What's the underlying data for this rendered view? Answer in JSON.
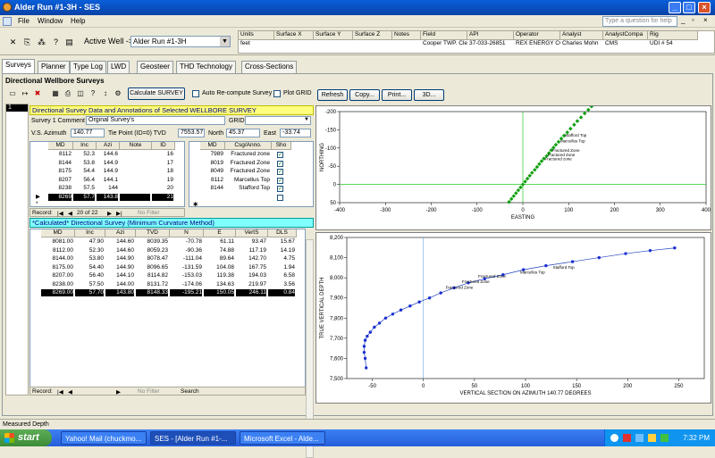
{
  "window": {
    "title": "Alder Run #1-3H - SES",
    "help_placeholder": "Type a question for help"
  },
  "menu": [
    "File",
    "Window",
    "Help"
  ],
  "toolbar": {
    "active_well_label": "Active Well ->",
    "active_well_value": "Alder Run #1-3H"
  },
  "info_grid": {
    "headers": [
      "Units",
      "Surface X",
      "Surface Y",
      "Surface Z",
      "Notes",
      "Field",
      "API",
      "Operator",
      "Analyst",
      "AnalystCompa",
      "Rig"
    ],
    "values": [
      "feet",
      "",
      "",
      "",
      "",
      "Cooper TWP. Cle",
      "37-033-26851",
      "REX ENERGY CO",
      "Charles Mohn",
      "CMS",
      "UDI # 54"
    ]
  },
  "tabs": [
    "Surveys",
    "Planner",
    "Type Log",
    "LWD",
    "Geosteer",
    "THD Technology",
    "Cross-Sections"
  ],
  "surveys": {
    "title": "Directional Wellbore Surveys",
    "calc_button": "Calculate SURVEY",
    "auto_label": "Auto Re-compute Survey",
    "plot_label": "Plot GRID",
    "row_num": "1",
    "section1_title": "Directional Survey Data and Annotations of Selected WELLBORE SURVEY",
    "comment_label": "Survey 1 Comment",
    "comment_value": "Orginal Survey's",
    "grid_label": "GRID",
    "vs_label": "V.S. Azimuth",
    "vs_value": "140.77",
    "tie_label": "Tie Point (ID=0)  TVD",
    "tie_value": "7553.57",
    "north_label": "North",
    "north_value": "45.37",
    "east_label": "East",
    "east_value": "-33.74",
    "survey_headers": [
      "MD",
      "Inc",
      "Azi",
      "Note",
      "ID"
    ],
    "survey_rows": [
      [
        "8112",
        "52.3",
        "144.6",
        "",
        "16"
      ],
      [
        "8144",
        "53.8",
        "144.9",
        "",
        "17"
      ],
      [
        "8175",
        "54.4",
        "144.9",
        "",
        "18"
      ],
      [
        "8207",
        "56.4",
        "144.1",
        "",
        "19"
      ],
      [
        "8238",
        "57.5",
        "144",
        "",
        "20"
      ],
      [
        "8269",
        "57.7",
        "143.8",
        "",
        "21"
      ]
    ],
    "annot_headers": [
      "MD",
      "Csg/Anno.",
      "Sho"
    ],
    "annot_rows": [
      [
        "7989",
        "Fractured zone"
      ],
      [
        "8019",
        "Fractured Zone"
      ],
      [
        "8049",
        "Fractured Zone"
      ],
      [
        "8112",
        "Marcellus Top"
      ],
      [
        "8144",
        "Stafford Top"
      ]
    ],
    "record1": {
      "label": "Record:",
      "text": "20 of 22",
      "filter": "No Filter"
    },
    "section2_title": "*Calculated* Directional Survey (Minimum Curvature Method)",
    "calc_headers": [
      "MD",
      "Inc",
      "Azi",
      "TVD",
      "N",
      "E",
      "VertS",
      "DLS"
    ],
    "calc_rows": [
      [
        "8081.00",
        "47.90",
        "144.60",
        "8039.35",
        "-70.78",
        "61.11",
        "93.47",
        "15.67"
      ],
      [
        "8112.00",
        "52.30",
        "144.60",
        "8059.23",
        "-90.36",
        "74.88",
        "117.19",
        "14.19"
      ],
      [
        "8144.00",
        "53.80",
        "144.90",
        "8078.47",
        "-111.04",
        "89.64",
        "142.70",
        "4.75"
      ],
      [
        "8175.00",
        "54.40",
        "144.90",
        "8096.65",
        "-131.59",
        "104.08",
        "167.75",
        "1.94"
      ],
      [
        "8207.00",
        "56.40",
        "144.10",
        "8114.82",
        "-153.03",
        "119.38",
        "194.03",
        "6.58"
      ],
      [
        "8238.00",
        "57.50",
        "144.00",
        "8131.72",
        "-174.06",
        "134.63",
        "219.97",
        "3.56"
      ],
      [
        "8269.00",
        "57.70",
        "143.80",
        "8148.33",
        "-195.21",
        "150.05",
        "246.11",
        "0.84"
      ]
    ],
    "record2": {
      "label": "Record:",
      "filter": "No Filter",
      "search": "Search"
    }
  },
  "chart_buttons": [
    "Refresh",
    "Copy...",
    "Print...",
    "3D..."
  ],
  "chart_data": [
    {
      "type": "scatter",
      "xlabel": "EASTING",
      "ylabel": "NORTHING",
      "xlim": [
        -400,
        400
      ],
      "ylim": [
        -200,
        50
      ],
      "xticks": [
        -400,
        -300,
        -200,
        -100,
        0,
        100,
        200,
        300,
        400
      ],
      "yticks": [
        50,
        0,
        -50,
        -100,
        -150,
        -200
      ],
      "points": [
        [
          -30,
          48
        ],
        [
          -25,
          40
        ],
        [
          -20,
          32
        ],
        [
          -15,
          24
        ],
        [
          -10,
          16
        ],
        [
          -5,
          8
        ],
        [
          0,
          0
        ],
        [
          5,
          -8
        ],
        [
          10,
          -16
        ],
        [
          15,
          -24
        ],
        [
          20,
          -32
        ],
        [
          26,
          -40
        ],
        [
          31,
          -48
        ],
        [
          36,
          -56
        ],
        [
          41,
          -64
        ],
        [
          46,
          -71
        ],
        [
          52,
          -78
        ],
        [
          57,
          -86
        ],
        [
          62,
          -94
        ],
        [
          67,
          -101
        ],
        [
          72,
          -109
        ],
        [
          78,
          -117
        ],
        [
          84,
          -126
        ],
        [
          90,
          -134
        ],
        [
          97,
          -143
        ],
        [
          104,
          -153
        ],
        [
          112,
          -164
        ],
        [
          119,
          -174
        ],
        [
          127,
          -184
        ],
        [
          135,
          -195
        ],
        [
          143,
          -205
        ],
        [
          150,
          -214
        ]
      ],
      "annotations": [
        {
          "text": "Fractured zone",
          "x": 44,
          "y": -66
        },
        {
          "text": "Fractured Zone",
          "x": 50,
          "y": -78
        },
        {
          "text": "Fractured Zone",
          "x": 60,
          "y": -90
        },
        {
          "text": "Marcellus Top",
          "x": 78,
          "y": -115
        },
        {
          "text": "Stafford Top",
          "x": 88,
          "y": -131
        }
      ]
    },
    {
      "type": "line",
      "xlabel": "VERTICAL SECTION ON AZIMUTH 140.77 DEGREES",
      "ylabel": "TRUE VERTICAL DEPTH",
      "xlim": [
        -75,
        275
      ],
      "ylim": [
        8200,
        7500
      ],
      "xticks": [
        -50,
        0,
        50,
        100,
        150,
        200,
        250
      ],
      "yticks": [
        7500,
        7600,
        7700,
        7800,
        7900,
        8000,
        8100,
        8200
      ],
      "x": [
        -56,
        -57,
        -58,
        -58,
        -57,
        -55,
        -52,
        -48,
        -43,
        -37,
        -30,
        -22,
        -13,
        -4,
        6,
        17,
        30,
        44,
        60,
        78,
        98,
        120,
        146,
        172,
        198,
        222,
        246
      ],
      "y": [
        7553,
        7600,
        7630,
        7660,
        7690,
        7710,
        7730,
        7755,
        7775,
        7800,
        7820,
        7840,
        7860,
        7880,
        7900,
        7925,
        7950,
        7975,
        7995,
        8015,
        8040,
        8060,
        8080,
        8100,
        8120,
        8135,
        8148
      ],
      "annotations": [
        {
          "text": "Fractured Zone",
          "x": 20,
          "y": 7945
        },
        {
          "text": "Fractured Zone",
          "x": 36,
          "y": 7975
        },
        {
          "text": "Fractured Zone",
          "x": 52,
          "y": 8000
        },
        {
          "text": "Marcellus Top",
          "x": 93,
          "y": 8020
        },
        {
          "text": "Stafford Top",
          "x": 125,
          "y": 8045
        }
      ]
    }
  ],
  "status": "Measured Depth",
  "taskbar": {
    "start": "start",
    "items": [
      "Yahoo! Mail (chuckmo...",
      "SES - [Alder Run #1-...",
      "Microsoft Excel - Alde..."
    ],
    "clock": "7:32 PM"
  }
}
